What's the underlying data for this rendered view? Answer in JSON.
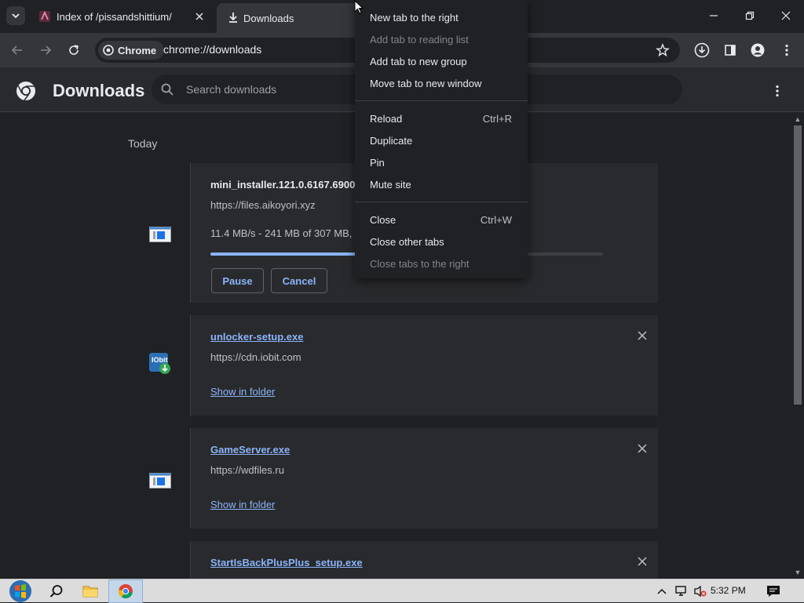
{
  "tabs": [
    {
      "title": "Index of /pissandshittium/",
      "active": false
    },
    {
      "title": "Downloads",
      "active": true
    }
  ],
  "toolbar": {
    "chip_label": "Chrome",
    "url": "chrome://downloads"
  },
  "downloads_page": {
    "title": "Downloads",
    "search_placeholder": "Search downloads",
    "section_label": "Today",
    "items": [
      {
        "filename": "mini_installer.121.0.6167.6900.exe",
        "source": "https://files.aikoyori.xyz",
        "status": "11.4 MB/s - 241 MB of 307 MB, 6 secs left",
        "progress": 0.78,
        "pause_label": "Pause",
        "cancel_label": "Cancel"
      },
      {
        "filename": "unlocker-setup.exe",
        "source": "https://cdn.iobit.com",
        "action": "Show in folder"
      },
      {
        "filename": "GameServer.exe",
        "source": "https://wdfiles.ru",
        "action": "Show in folder"
      },
      {
        "filename": "StartIsBackPlusPlus_setup.exe",
        "source": ""
      }
    ]
  },
  "context_menu": {
    "groups": [
      [
        {
          "label": "New tab to the right",
          "shortcut": "",
          "disabled": false
        },
        {
          "label": "Add tab to reading list",
          "shortcut": "",
          "disabled": true
        },
        {
          "label": "Add tab to new group",
          "shortcut": "",
          "disabled": false
        },
        {
          "label": "Move tab to new window",
          "shortcut": "",
          "disabled": false
        }
      ],
      [
        {
          "label": "Reload",
          "shortcut": "Ctrl+R",
          "disabled": false
        },
        {
          "label": "Duplicate",
          "shortcut": "",
          "disabled": false
        },
        {
          "label": "Pin",
          "shortcut": "",
          "disabled": false
        },
        {
          "label": "Mute site",
          "shortcut": "",
          "disabled": false
        }
      ],
      [
        {
          "label": "Close",
          "shortcut": "Ctrl+W",
          "disabled": false
        },
        {
          "label": "Close other tabs",
          "shortcut": "",
          "disabled": false
        },
        {
          "label": "Close tabs to the right",
          "shortcut": "",
          "disabled": true
        }
      ]
    ]
  },
  "taskbar": {
    "clock": "5:32 PM"
  },
  "colors": {
    "accent": "#8ab4f8",
    "background": "#202124",
    "card": "#292a2d",
    "toolbar": "#35363a"
  }
}
